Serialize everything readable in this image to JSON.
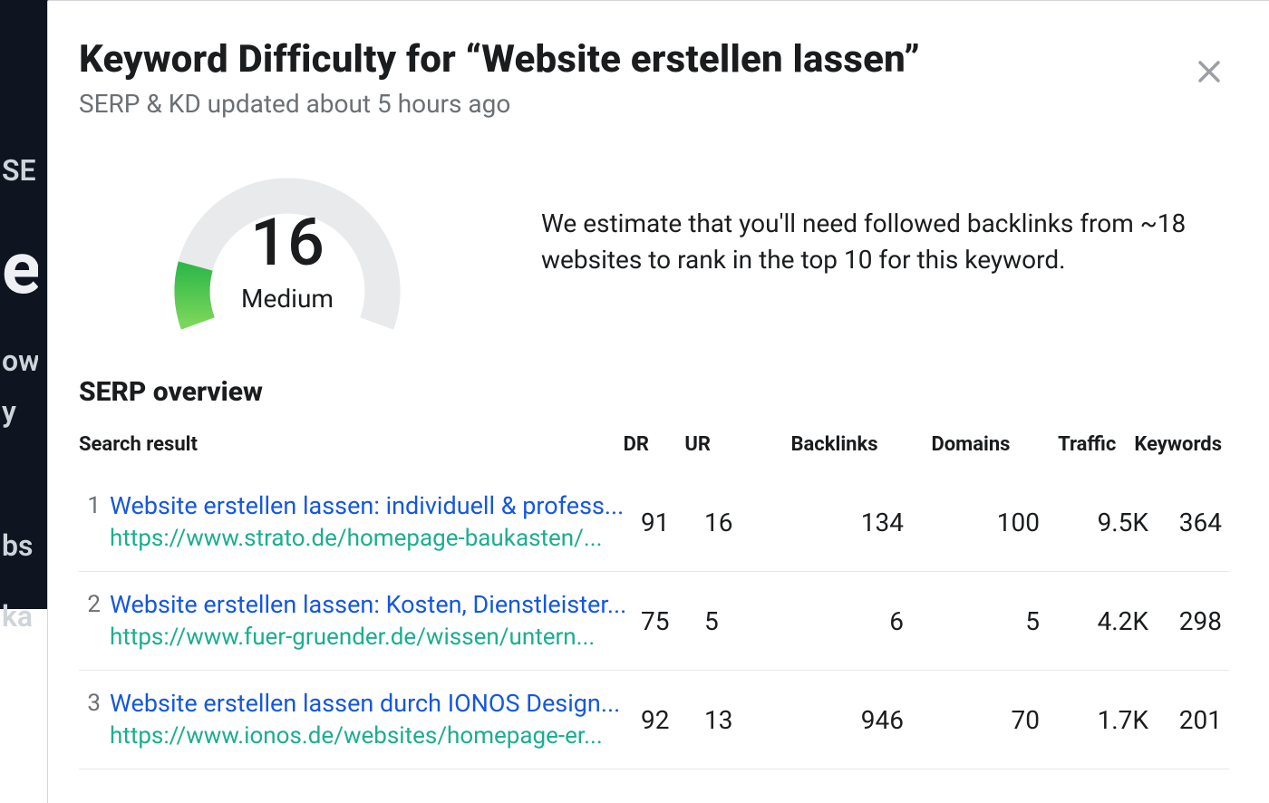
{
  "header": {
    "title": "Keyword Difficulty for “Website erstellen lassen”",
    "subtitle": "SERP & KD updated about 5 hours ago"
  },
  "gauge": {
    "value": "16",
    "label": "Medium",
    "fill_fraction": 0.16,
    "track_color": "#e8eaec",
    "fill_start": "#7ad65a",
    "fill_end": "#2fb84a"
  },
  "estimate_text": "We estimate that you'll need followed backlinks from ~18 websites to rank in the top 10 for this keyword.",
  "serp_heading": "SERP overview",
  "columns": {
    "search": "Search result",
    "dr": "DR",
    "ur": "UR",
    "backlinks": "Backlinks",
    "domains": "Domains",
    "traffic": "Traffic",
    "keywords": "Keywords"
  },
  "rows": [
    {
      "rank": "1",
      "title": "Website erstellen lassen: individuell & profess...",
      "url": "https://www.strato.de/homepage-baukasten/...",
      "dr": "91",
      "ur": "16",
      "backlinks": "134",
      "domains": "100",
      "traffic": "9.5K",
      "keywords": "364"
    },
    {
      "rank": "2",
      "title": "Website erstellen lassen: Kosten, Dienstleister...",
      "url": "https://www.fuer-gruender.de/wissen/untern...",
      "dr": "75",
      "ur": "5",
      "backlinks": "6",
      "domains": "5",
      "traffic": "4.2K",
      "keywords": "298"
    },
    {
      "rank": "3",
      "title": "Website erstellen lassen durch IONOS Design...",
      "url": "https://www.ionos.de/websites/homepage-er...",
      "dr": "92",
      "ur": "13",
      "backlinks": "946",
      "domains": "70",
      "traffic": "1.7K",
      "keywords": "201"
    }
  ],
  "sidebar_hints": [
    "SE",
    "e",
    "ow",
    "y",
    "bs",
    "ka"
  ]
}
